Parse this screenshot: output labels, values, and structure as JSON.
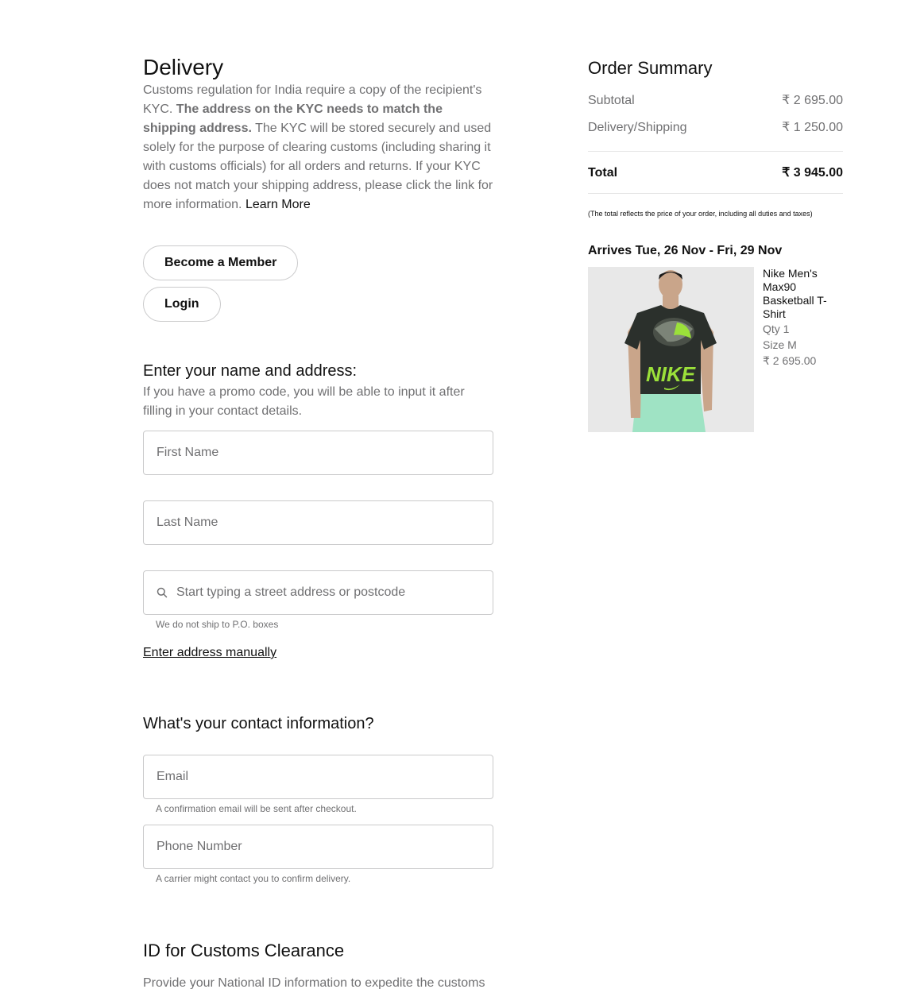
{
  "delivery": {
    "title": "Delivery",
    "kyc_intro": "Customs regulation for India require a copy of the recipient's KYC. ",
    "kyc_bold": "The address on the KYC needs to match the shipping address.",
    "kyc_rest": " The KYC will be stored securely and used solely for the purpose of clearing customs (including sharing it with customs officials) for all orders and returns. If your KYC does not match your shipping address, please click the link for more information. ",
    "learn_more": "Learn More",
    "member_button": "Become a Member",
    "login_button": "Login"
  },
  "name_address": {
    "title": "Enter your name and address:",
    "subtitle": "If you have a promo code, you will be able to input it after filling in your contact details.",
    "first_name_placeholder": "First Name",
    "last_name_placeholder": "Last Name",
    "address_placeholder": "Start typing a street address or postcode",
    "po_box_hint": "We do not ship to P.O. boxes",
    "manual_link": "Enter address manually"
  },
  "contact": {
    "title": "What's your contact information?",
    "email_placeholder": "Email",
    "email_hint": "A confirmation email will be sent after checkout.",
    "phone_placeholder": "Phone Number",
    "phone_hint": "A carrier might contact you to confirm delivery."
  },
  "customs": {
    "title": "ID for Customs Clearance",
    "text": "Provide your National ID information to expedite the customs"
  },
  "summary": {
    "title": "Order Summary",
    "subtotal_label": "Subtotal",
    "subtotal_value": "₹ 2 695.00",
    "shipping_label": "Delivery/Shipping",
    "shipping_value": "₹ 1 250.00",
    "total_label": "Total",
    "total_value": "₹ 3 945.00",
    "note": "(The total reflects the price of your order, including all duties and taxes)",
    "arrives": "Arrives Tue, 26 Nov - Fri, 29 Nov"
  },
  "product": {
    "name": "Nike Men's Max90 Basketball T-Shirt",
    "qty": "Qty 1",
    "size": "Size M",
    "price": "₹ 2 695.00",
    "shirt_print": "NIKE",
    "colors": {
      "shirt": "#2b302c",
      "print": "#9be03a",
      "shorts": "#9fe3c4",
      "background": "#e8e8e8"
    }
  }
}
